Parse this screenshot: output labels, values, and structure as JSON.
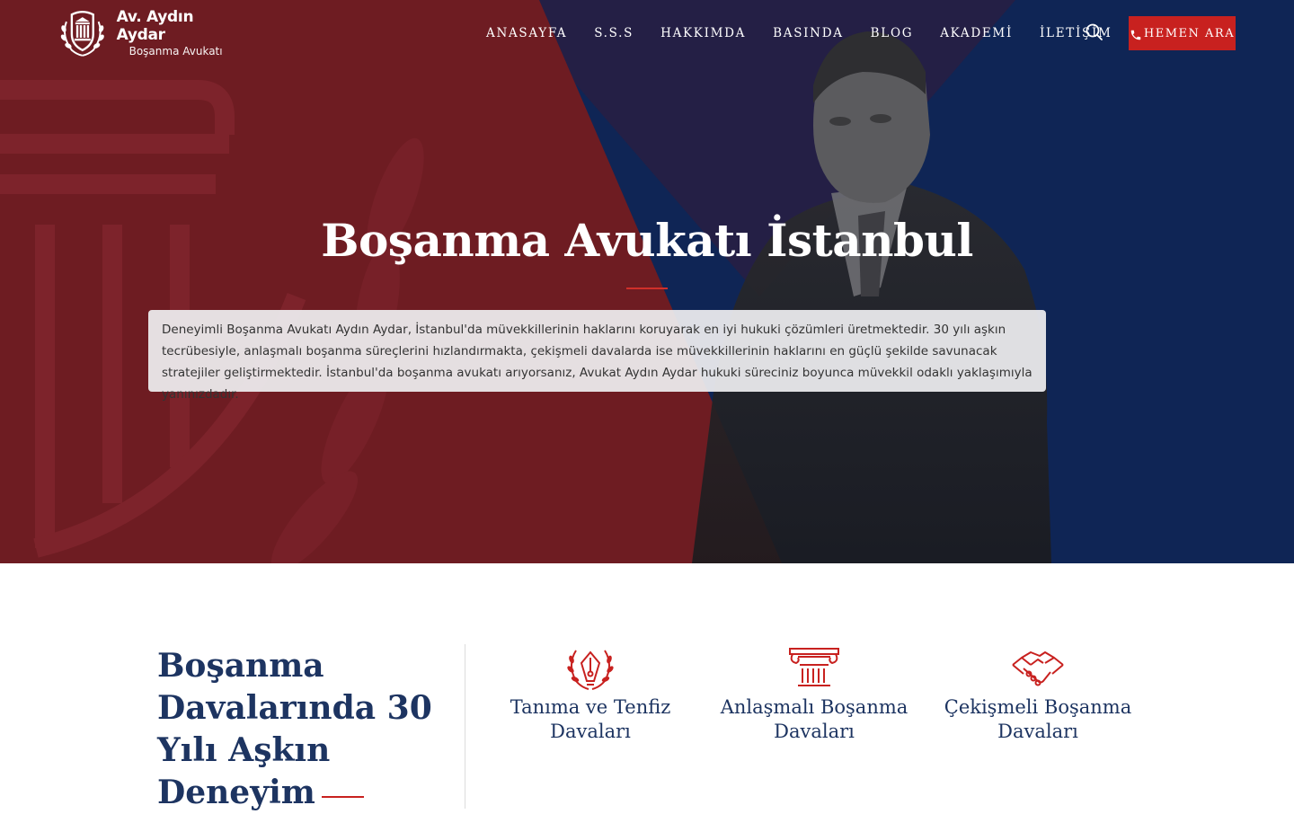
{
  "brand": {
    "name": "Av. Aydın Aydar",
    "tagline": "Boşanma Avukatı",
    "emblem_icon": "laurel-courthouse-shield-icon"
  },
  "nav": {
    "items": [
      {
        "label": "ANASAYFA"
      },
      {
        "label": "S.S.S"
      },
      {
        "label": "HAKKIMDA"
      },
      {
        "label": "BASINDA"
      },
      {
        "label": "BLOG"
      },
      {
        "label": "AKADEMİ"
      },
      {
        "label": "İLETİŞİM"
      }
    ],
    "search_icon": "search-icon",
    "cta": {
      "label": "HEMEN ARA",
      "icon": "phone-icon"
    }
  },
  "hero": {
    "title": "Boşanma Avukatı İstanbul",
    "description": "Deneyimli Boşanma Avukatı Aydın Aydar, İstanbul'da müvekkillerinin haklarını koruyarak en iyi hukuki çözümleri üretmektedir. 30 yılı aşkın tecrübesiyle, anlaşmalı boşanma süreçlerini hızlandırmakta, çekişmeli davalarda ise müvekkillerinin haklarını en güçlü şekilde savunacak stratejiler geliştirmektedir. İstanbul'da boşanma avukatı arıyorsanız, Avukat Aydın Aydar hukuki süreciniz boyunca müvekkil odaklı yaklaşımıyla yanınızdadır."
  },
  "experience": {
    "title": "Boşanma Davalarında 30 Yılı Aşkın Deneyim"
  },
  "services": [
    {
      "title": "Tanıma ve Tenfiz Davaları",
      "icon": "pen-nib-laurel-icon"
    },
    {
      "title": "Anlaşmalı Boşanma Davaları",
      "icon": "column-capital-icon"
    },
    {
      "title": "Çekişmeli Boşanma Davaları",
      "icon": "handshake-icon"
    }
  ],
  "colors": {
    "hero_red": "#6e1c22",
    "hero_navy": "#0f2555",
    "hero_purple": "#241f45",
    "accent_red": "#c8211f",
    "heading_navy": "#1d3461"
  }
}
